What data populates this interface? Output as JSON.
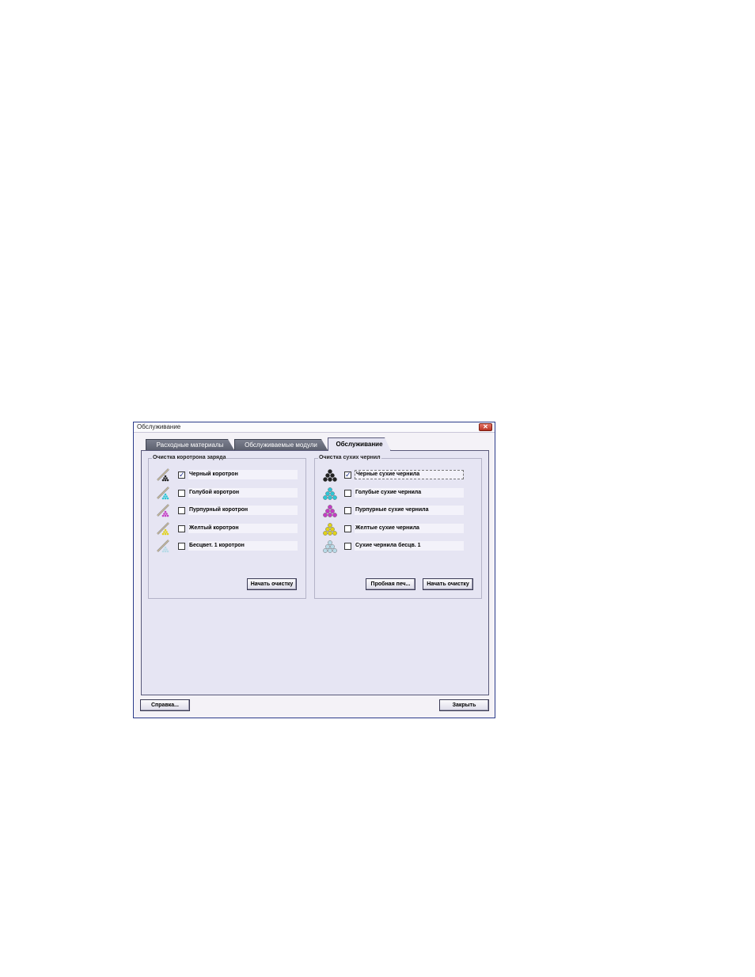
{
  "window": {
    "title": "Обслуживание",
    "close_glyph": "✕"
  },
  "tabs": [
    {
      "label": "Расходные материалы",
      "active": false
    },
    {
      "label": "Обслуживаемые модули",
      "active": false
    },
    {
      "label": "Обслуживание",
      "active": true
    }
  ],
  "corotron_group": {
    "title": "Очистка коротрона заряда",
    "items": [
      {
        "label": "Черный коротрон",
        "checked": true,
        "color": "#222222"
      },
      {
        "label": "Голубой коротрон",
        "checked": false,
        "color": "#2ec6d6"
      },
      {
        "label": "Пурпурный коротрон",
        "checked": false,
        "color": "#c43ec4"
      },
      {
        "label": "Желтый коротрон",
        "checked": false,
        "color": "#e0d21a"
      },
      {
        "label": "Бесцвет. 1 коротрон",
        "checked": false,
        "color": "#b9dbe8"
      }
    ],
    "start_button": "Начать очистку"
  },
  "dry_ink_group": {
    "title": "Очистка сухих чернил",
    "items": [
      {
        "label": "Черные сухие чернила",
        "checked": true,
        "color": "#222222"
      },
      {
        "label": "Голубые сухие чернила",
        "checked": false,
        "color": "#2ec6d6"
      },
      {
        "label": "Пурпурные сухие чернила",
        "checked": false,
        "color": "#c43ec4"
      },
      {
        "label": "Желтые сухие чернила",
        "checked": false,
        "color": "#e0d21a"
      },
      {
        "label": "Сухие чернила бесцв. 1",
        "checked": false,
        "color": "#b9dbe8"
      }
    ],
    "test_print_button": "Пробная печ...",
    "start_button": "Начать очистку"
  },
  "footer": {
    "help_button": "Справка...",
    "close_button": "Закрыть"
  },
  "icons": {
    "corotron": "corotron-icon",
    "dry_ink": "dry-ink-icon",
    "check_glyph": "✓"
  }
}
